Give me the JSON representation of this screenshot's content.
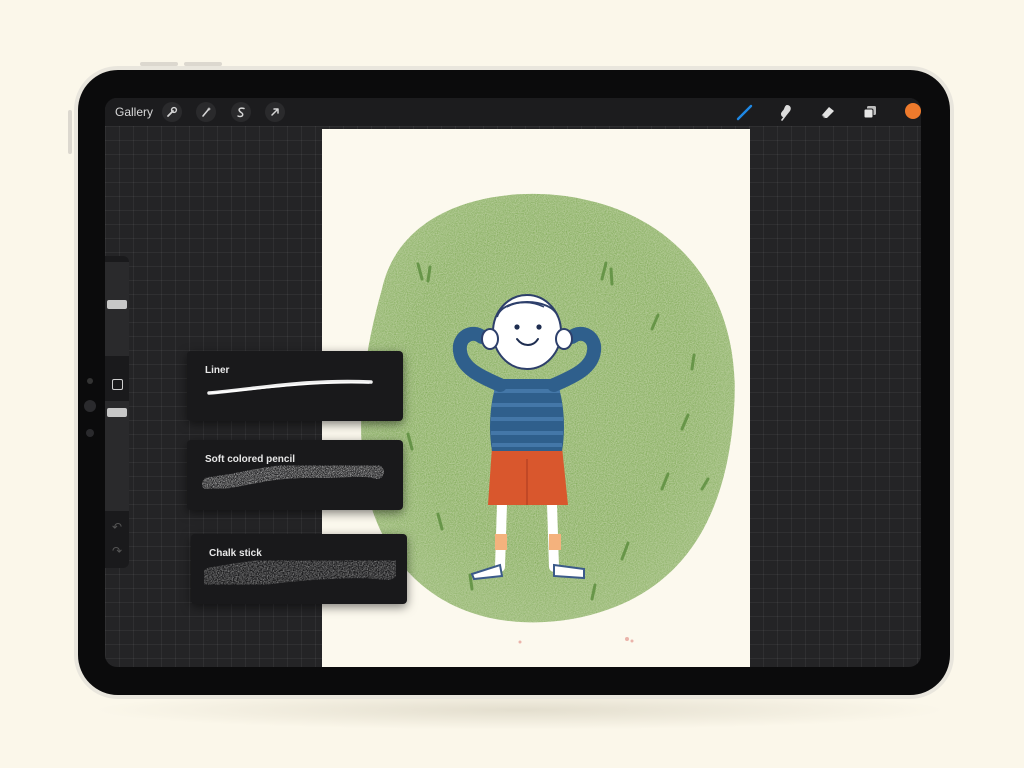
{
  "toolbar": {
    "gallery_label": "Gallery",
    "left_icons": [
      "wrench-icon",
      "magic-wand-icon",
      "selection-s-icon",
      "transform-arrow-icon"
    ],
    "right_icons": [
      "brush-icon",
      "smudge-icon",
      "eraser-icon",
      "layers-icon"
    ],
    "current_color": "#ee7a2c",
    "active_tool_color": "#1e88e5"
  },
  "brushes": [
    {
      "name": "Liner"
    },
    {
      "name": "Soft colored pencil"
    },
    {
      "name": "Chalk stick"
    }
  ],
  "colors": {
    "grass": "#7aa651",
    "shirt": "#2f5f8c",
    "shorts": "#d9572d",
    "paper": "#fcf9ee"
  }
}
